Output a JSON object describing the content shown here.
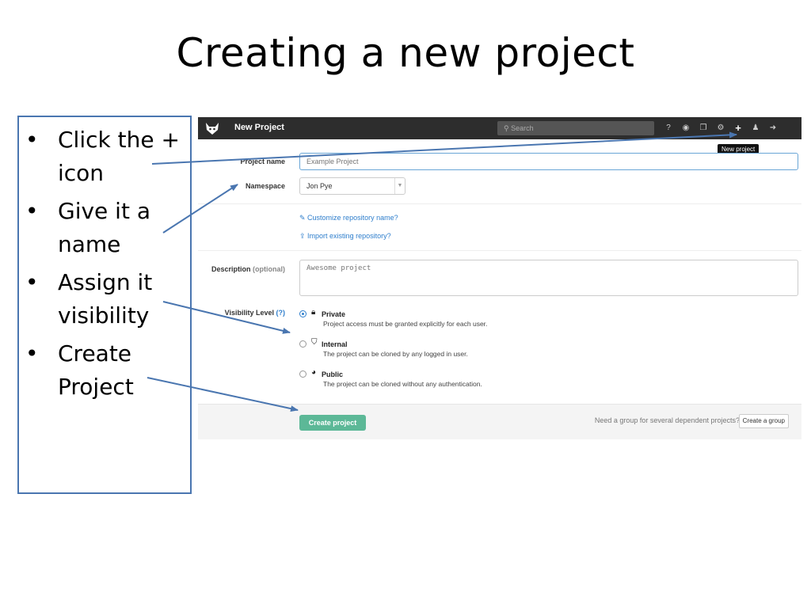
{
  "slide": {
    "title": "Creating a new project",
    "bullets": [
      {
        "dot": "•",
        "text": "Click the + icon"
      },
      {
        "dot": "•",
        "text": "Give it a name"
      },
      {
        "dot": "•",
        "text": "Assign it visibility"
      },
      {
        "dot": "•",
        "text": "Create Project"
      }
    ]
  },
  "app": {
    "topbar": {
      "title": "New Project",
      "search_placeholder": "Search",
      "icons": [
        "help-icon",
        "globe-icon",
        "copy-icon",
        "gears-icon",
        "plus-icon",
        "user-icon",
        "sign-out-icon"
      ],
      "tooltip": "New project"
    },
    "form": {
      "project_name_label": "Project name",
      "project_name_placeholder": "Example Project",
      "namespace_label": "Namespace",
      "namespace_value": "Jon Pye",
      "customize_link": "Customize repository name?",
      "import_link": "Import existing repository?",
      "description_label": "Description",
      "description_optional": "(optional)",
      "description_placeholder": "Awesome project",
      "visibility_label": "Visibility Level",
      "visibility_help": "(?)",
      "visibility_options": [
        {
          "title": "Private",
          "desc": "Project access must be granted explicitly for each user.",
          "selected": true,
          "icon": "lock-icon"
        },
        {
          "title": "Internal",
          "desc": "The project can be cloned by any logged in user.",
          "selected": false,
          "icon": "shield-icon"
        },
        {
          "title": "Public",
          "desc": "The project can be cloned without any authentication.",
          "selected": false,
          "icon": "globe-icon"
        }
      ]
    },
    "footer": {
      "create_button": "Create project",
      "group_text": "Need a group for several dependent projects?",
      "group_button": "Create a group"
    }
  },
  "colors": {
    "topbar": "#2d2d2d",
    "create_button": "#5cb897",
    "link": "#2e7ecc",
    "annotation": "#4a76b0"
  }
}
